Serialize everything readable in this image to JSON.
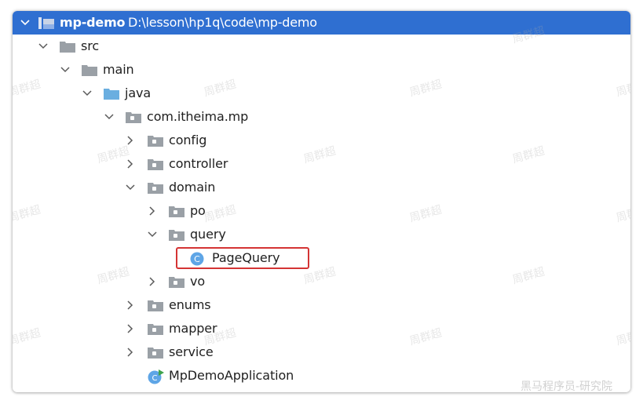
{
  "header": {
    "project_name": "mp-demo",
    "project_path": "D:\\lesson\\hp1q\\code\\mp-demo",
    "background": "#2f6fd1"
  },
  "tree": {
    "src": "src",
    "main": "main",
    "java": "java",
    "package": "com.itheima.mp",
    "config": "config",
    "controller": "controller",
    "domain": "domain",
    "po": "po",
    "query": "query",
    "page_query": "PageQuery",
    "vo": "vo",
    "enums": "enums",
    "mapper": "mapper",
    "service": "service",
    "app_class": "MpDemoApplication"
  },
  "class_icon_letter": "C",
  "highlight_color": "#d43434",
  "watermark_text": "周群超",
  "corner_watermark": "黑马程序员-研究院"
}
